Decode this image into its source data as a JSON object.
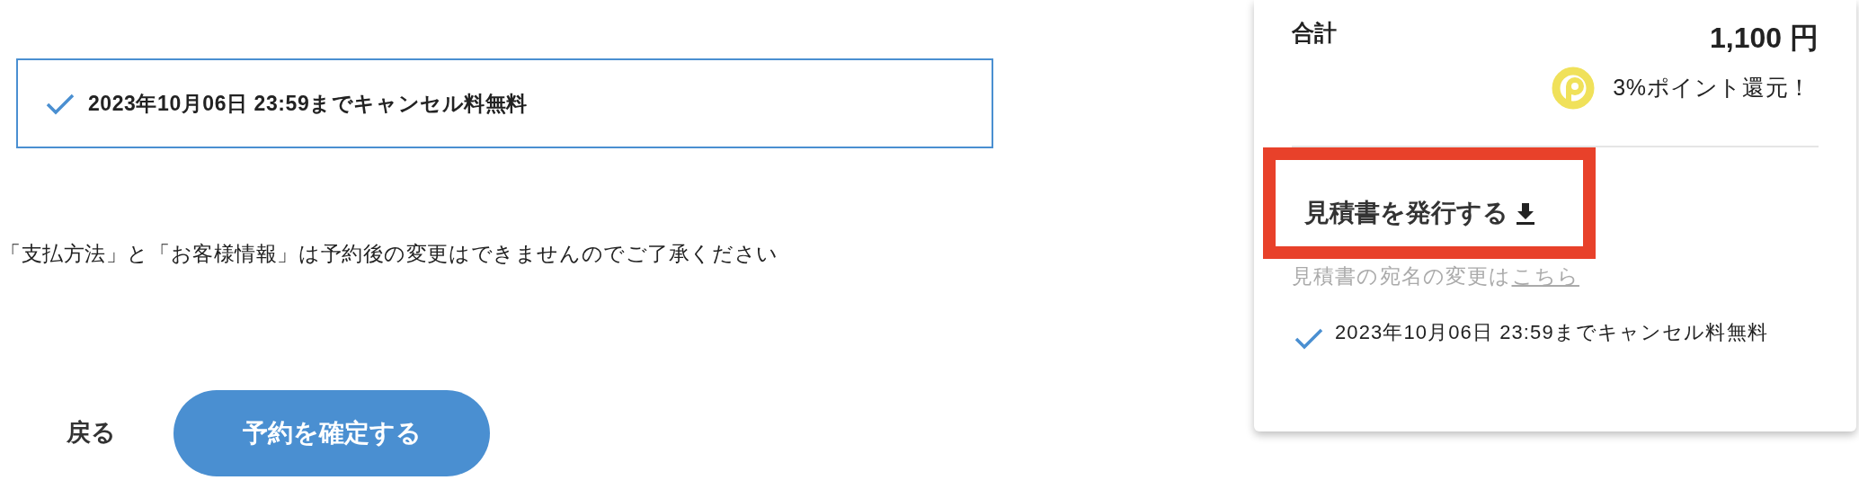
{
  "cancel_box": {
    "checked": true,
    "text": "2023年10月06日 23:59までキャンセル料無料"
  },
  "notice": "「支払方法」と「お客様情報」は予約後の変更はできませんのでご了承ください",
  "actions": {
    "back": "戻る",
    "confirm": "予約を確定する"
  },
  "summary": {
    "total_label": "合計",
    "total_value": "1,100 円",
    "points": "3%ポイント還元！",
    "estimate": {
      "label": "見積書を発行する",
      "highlighted": true
    },
    "addressee_note": "見積書の宛名の変更は",
    "addressee_link": "こちら",
    "cancel_note": {
      "checked": true,
      "text": "2023年10月06日 23:59までキャンセル料無料"
    }
  }
}
